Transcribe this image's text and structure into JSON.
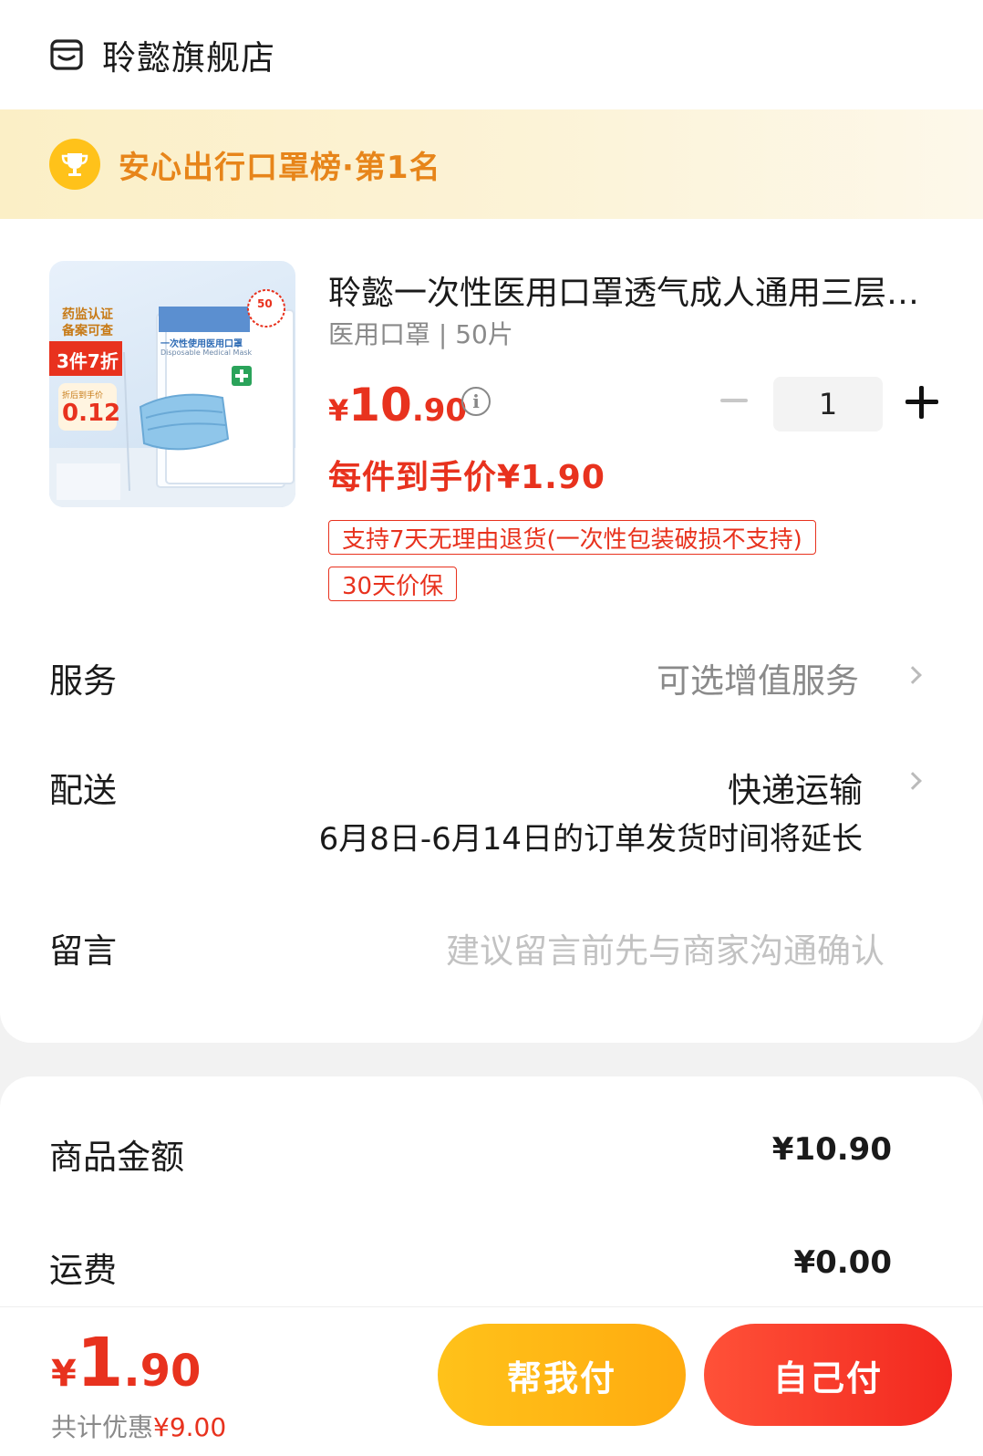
{
  "shop": {
    "name": "聆懿旗舰店"
  },
  "rank_banner": {
    "text": "安心出行口罩榜·第1名"
  },
  "product": {
    "title": "聆懿一次性医用口罩透气成人通用三层防护口罩",
    "spec": "医用口罩 | 50片",
    "price_symbol": "¥",
    "price_int": "10",
    "price_dec": ".90",
    "unit_price": "每件到手价¥1.90",
    "quantity": "1",
    "tags": [
      "支持7天无理由退货(一次性包装破损不支持)",
      "30天价保"
    ],
    "thumbnail": {
      "badge_top": "药监认证",
      "badge_top2": "备案可查",
      "promo": "3件7折",
      "price_label": "折后到手价",
      "price_value": "0.12",
      "pack_title_cn": "一次性使用医用口罩",
      "pack_title_en": "Disposable Medical Mask",
      "count_badge": "50"
    }
  },
  "rows": {
    "service": {
      "label": "服务",
      "value": "可选增值服务"
    },
    "delivery": {
      "label": "配送",
      "value": "快递运输",
      "note": "6月8日-6月14日的订单发货时间将延长"
    },
    "message": {
      "label": "留言",
      "placeholder": "建议留言前先与商家沟通确认"
    }
  },
  "summary": {
    "goods_label": "商品金额",
    "goods_value": "¥10.90",
    "shipping_label": "运费",
    "shipping_value": "¥0.00"
  },
  "footer": {
    "total_symbol": "¥",
    "total_int": "1",
    "total_dec": ".90",
    "discount_label": "共计优惠",
    "discount_value": "¥9.00",
    "help_pay": "帮我付",
    "self_pay": "自己付"
  },
  "colors": {
    "accent": "#e8321e",
    "gold": "#ffc21a",
    "banner_text": "#e7851a"
  },
  "icons": {
    "shop": "store-icon",
    "trophy": "trophy-icon",
    "info": "info-icon",
    "chevron": "chevron-right-icon"
  }
}
